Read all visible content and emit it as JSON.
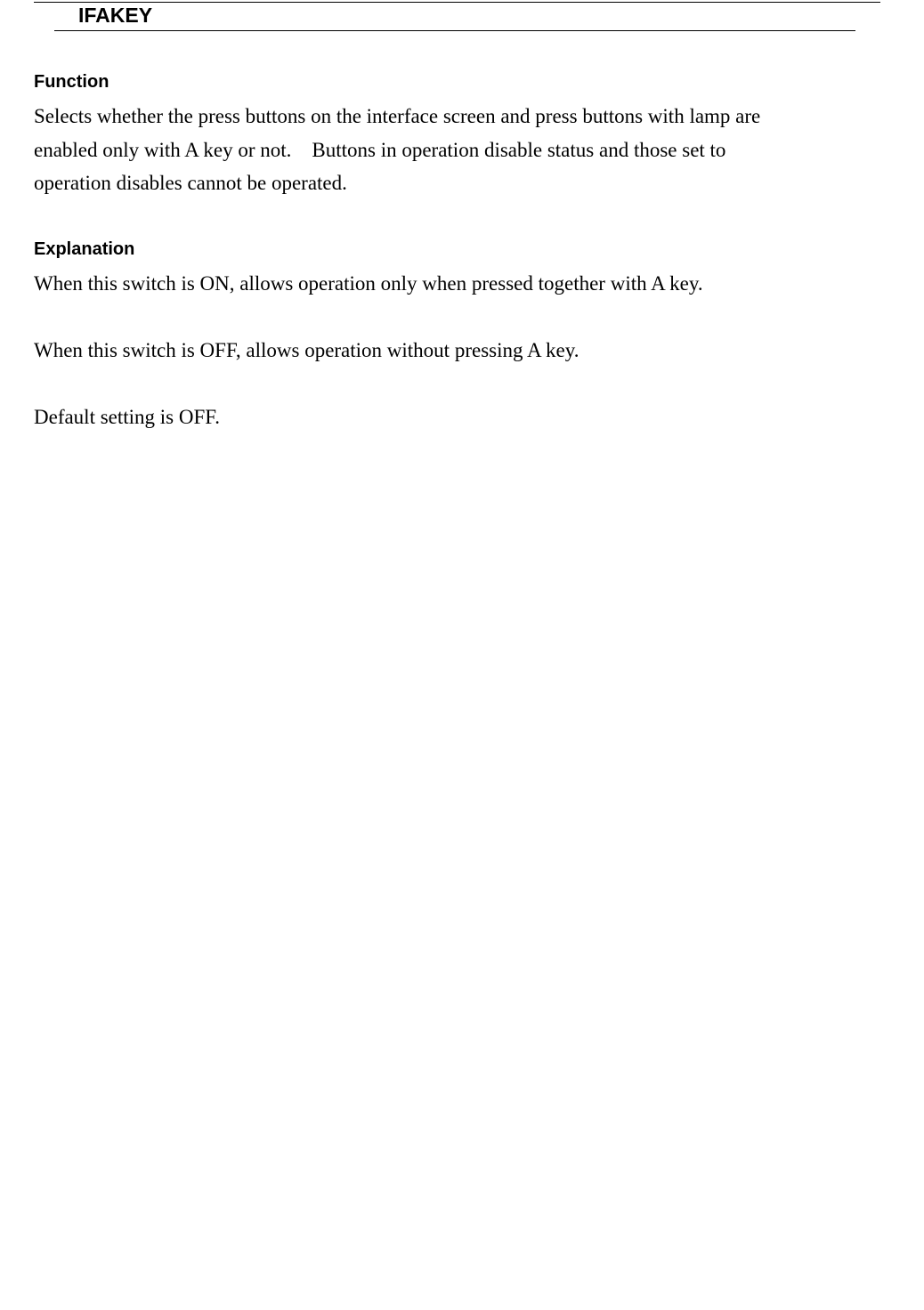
{
  "header": {
    "title": "IFAKEY"
  },
  "function": {
    "heading": "Function",
    "text_lines": [
      "Selects whether the press buttons on the interface screen and press buttons with lamp are",
      "enabled only with A key or not.    Buttons in operation disable status and those set to",
      "operation disables cannot be operated."
    ]
  },
  "explanation": {
    "heading": "Explanation",
    "lines": [
      "When this switch is ON, allows operation only when pressed together with A key.",
      "When this switch is OFF, allows operation without pressing A key.",
      "Default setting is OFF."
    ]
  }
}
